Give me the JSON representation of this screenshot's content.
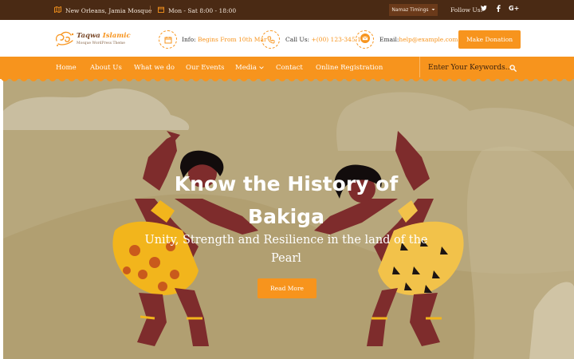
{
  "topbar": {
    "location": "New Orleans, Jamia Mosque",
    "hours": "Mon - Sat 8:00 - 18:00",
    "timings_label": "Namaz Timings",
    "follow_label": "Follow Us:",
    "social": [
      "twitter-icon",
      "facebook-icon",
      "google-plus-icon"
    ]
  },
  "header": {
    "logo_name": "Taqwa",
    "logo_name_accent": "Islamic",
    "logo_tagline": "Mosque WordPress Theme",
    "info_label": "Info:",
    "info_value": "Begins From 10th Mar",
    "call_label": "Call Us:",
    "call_value": "+(00) 123-345-11",
    "email_label": "Email:",
    "email_value": "help@example.com",
    "donate_label": "Make Donation"
  },
  "nav": {
    "items": [
      "Home",
      "About Us",
      "What we do",
      "Our Events",
      "Media",
      "Contact",
      "Online Registration"
    ],
    "search_placeholder": "Enter Your Keywords..."
  },
  "hero": {
    "title_line1": "Know the History of",
    "title_line2": "Bakiga",
    "subtitle_line1": "Unity, Strength and Resilience in the land of the",
    "subtitle_line2": "Pearl",
    "button_label": "Read More"
  },
  "colors": {
    "accent": "#f7941d",
    "topbar_bg": "#4a2a14",
    "hero_bg": "#b8a77d"
  }
}
